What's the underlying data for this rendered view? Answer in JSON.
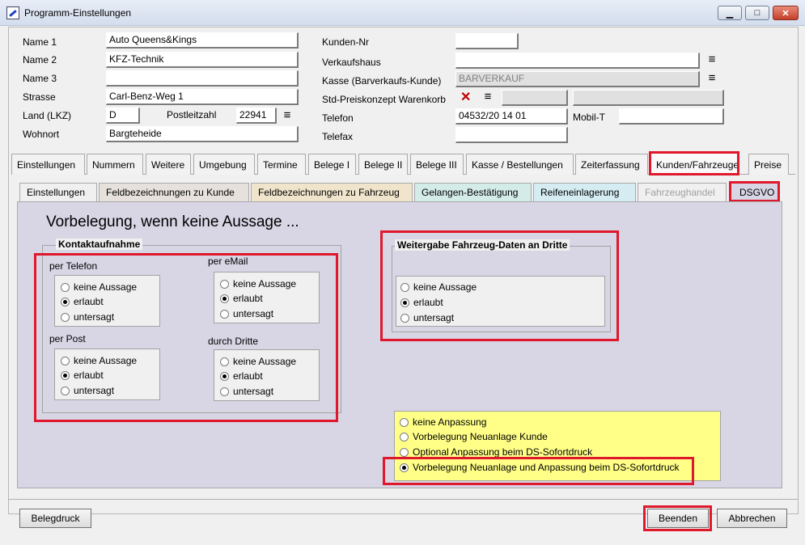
{
  "window": {
    "title": "Programm-Einstellungen",
    "min_label": "▁",
    "max_label": "□",
    "close_label": "✕"
  },
  "customer": {
    "name1_label": "Name 1",
    "name1_value": "Auto Queens&Kings",
    "name2_label": "Name 2",
    "name2_value": "KFZ-Technik",
    "name3_label": "Name 3",
    "name3_value": "",
    "street_label": "Strasse",
    "street_value": "Carl-Benz-Weg 1",
    "country_label": "Land (LKZ)",
    "country_value": "D",
    "zip_label": "Postleitzahl",
    "zip_value": "22941",
    "city_label": "Wohnort",
    "city_value": "Bargteheide",
    "custno_label": "Kunden-Nr",
    "custno_value": "",
    "store_label": "Verkaufshaus",
    "store_value": "",
    "register_label": "Kasse (Barverkaufs-Kunde)",
    "register_value": "BARVERKAUF",
    "price_label": "Std-Preiskonzept Warenkorb",
    "phone_label": "Telefon",
    "phone_value": "04532/20 14 01",
    "mobile_label": "Mobil-T",
    "mobile_value": "",
    "fax_label": "Telefax",
    "fax_value": ""
  },
  "tabs": [
    "Einstellungen",
    "Nummern",
    "Weitere",
    "Umgebung",
    "Termine",
    "Belege I",
    "Belege II",
    "Belege III",
    "Kasse / Bestellungen",
    "Zeiterfassung",
    "Kunden/Fahrzeuge",
    "Preise"
  ],
  "subtabs": [
    "Einstellungen",
    "Feldbezeichnungen zu Kunde",
    "Feldbezeichnungen zu Fahrzeug",
    "Gelangen-Bestätigung",
    "Reifeneinlagerung",
    "Fahrzeughandel",
    "DSGVO"
  ],
  "active_tab": "Kunden/Fahrzeuge",
  "active_subtab": "DSGVO",
  "panel": {
    "heading": "Vorbelegung, wenn keine Aussage ...",
    "contact_group": "Kontaktaufnahme",
    "phone_title": "per Telefon",
    "email_title": "per eMail",
    "post_title": "per Post",
    "third_title": "durch Dritte",
    "options": [
      "keine Aussage",
      "erlaubt",
      "untersagt"
    ],
    "vehicle_group": "Weitergabe Fahrzeug-Daten an Dritte",
    "adjust_options": [
      "keine Anpassung",
      "Vorbelegung Neuanlage Kunde",
      "Optional Anpassung beim DS-Sofortdruck",
      "Vorbelegung Neuanlage und Anpassung beim DS-Sofortdruck"
    ]
  },
  "buttons": {
    "print": "Belegdruck",
    "finish": "Beenden",
    "cancel": "Abbrechen"
  },
  "colors": {
    "highlight": "#e0182b",
    "panel": "#d8d5e5",
    "note": "#ffff88"
  }
}
